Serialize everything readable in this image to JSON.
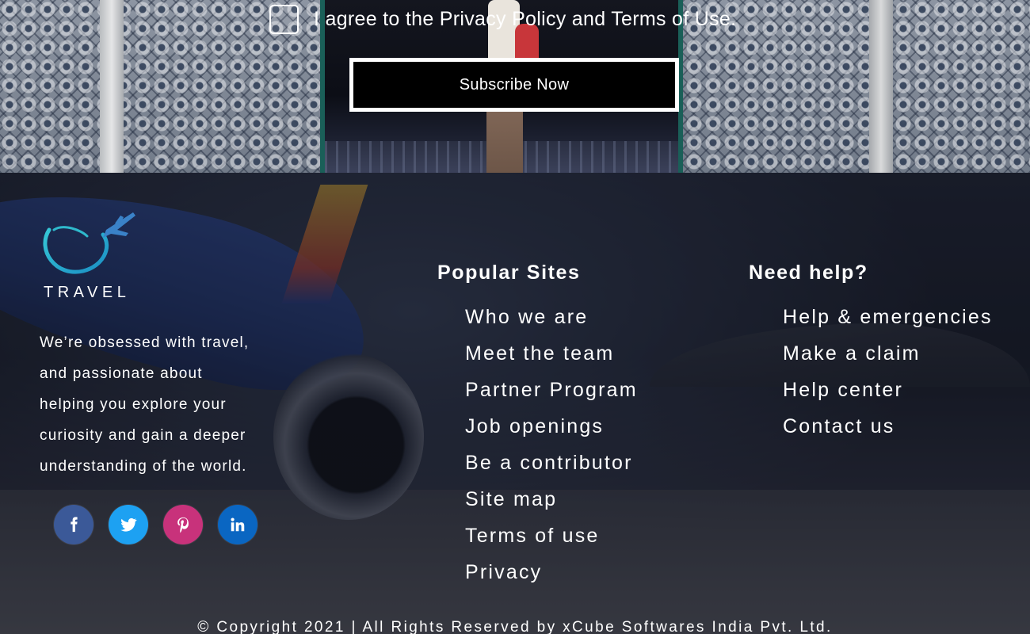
{
  "subscribe": {
    "agree_text": "I agree to the Privacy Policy and Terms of Use.",
    "button_label": "Subscribe Now"
  },
  "brand": {
    "logo_text": "TRAVEL",
    "about": " We’re obsessed with travel,\nand passionate about\nhelping you explore your\ncuriosity and gain a deeper\nunderstanding of the world."
  },
  "socials": [
    {
      "name": "facebook",
      "icon": "facebook-icon",
      "color": "#3b5998"
    },
    {
      "name": "twitter",
      "icon": "twitter-icon",
      "color": "#1da1f2"
    },
    {
      "name": "pinterest",
      "icon": "pinterest-icon",
      "color": "#c8327b"
    },
    {
      "name": "linkedin",
      "icon": "linkedin-icon",
      "color": "#0a66c2"
    }
  ],
  "popular_sites": {
    "title": "Popular Sites",
    "links": [
      "Who we are",
      "Meet the team",
      "Partner Program",
      "Job openings",
      "Be a contributor",
      "Site map",
      "Terms of use",
      "Privacy"
    ]
  },
  "need_help": {
    "title": "Need help?",
    "links": [
      "Help & emergencies",
      "Make a claim",
      "Help center",
      "Contact us"
    ]
  },
  "copyright": "© Copyright 2021 | All Rights Reserved by xCube Softwares India Pvt. Ltd."
}
